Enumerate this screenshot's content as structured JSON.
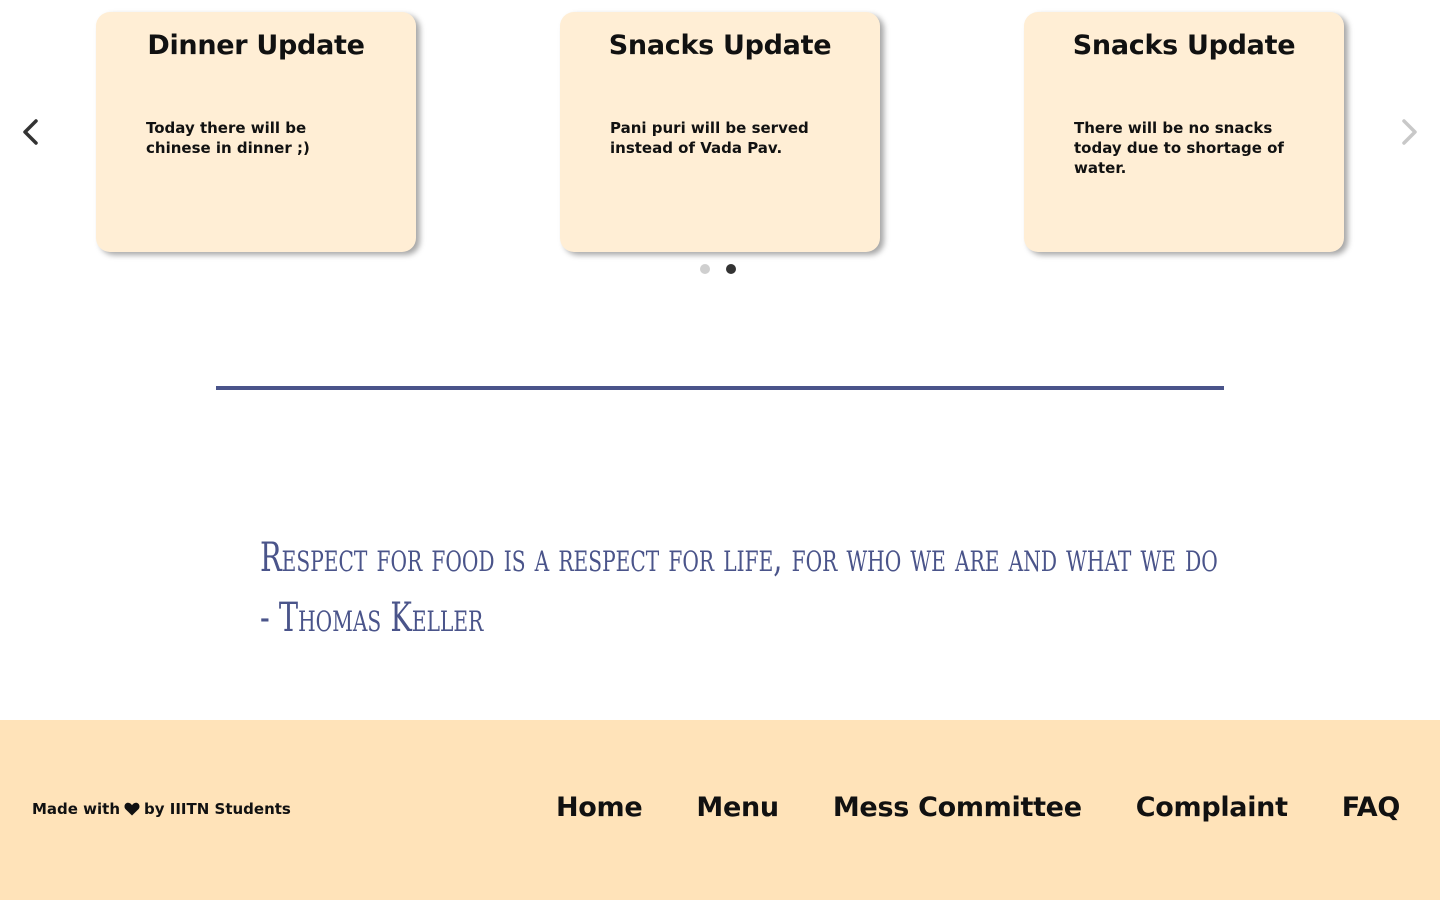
{
  "carousel": {
    "cards": [
      {
        "title": "Dinner Update",
        "body": "Today there will be chinese in dinner ;)"
      },
      {
        "title": "Snacks Update",
        "body": "Pani puri will be served instead of Vada Pav."
      },
      {
        "title": "Snacks Update",
        "body": "There will be no snacks today due to shortage of water."
      }
    ],
    "prev_icon": "chevron-left-icon",
    "next_icon": "chevron-right-icon",
    "page_count": 2,
    "active_page": 2
  },
  "quote": {
    "line1": "Respect for food is a respect for life, for who we are and what we do",
    "line2": "- Thomas Keller"
  },
  "footer": {
    "made_with_prefix": "Made with",
    "made_with_suffix": "by IIITN Students",
    "heart_icon": "heart-icon",
    "nav": [
      "Home",
      "Menu",
      "Mess Committee",
      "Complaint",
      "FAQ"
    ]
  },
  "colors": {
    "card_bg": "#ffeed5",
    "accent": "#4a548a",
    "footer_bg": "#ffe3b9",
    "active_dot": "#333333",
    "inactive_dot": "#cfcfcf"
  }
}
